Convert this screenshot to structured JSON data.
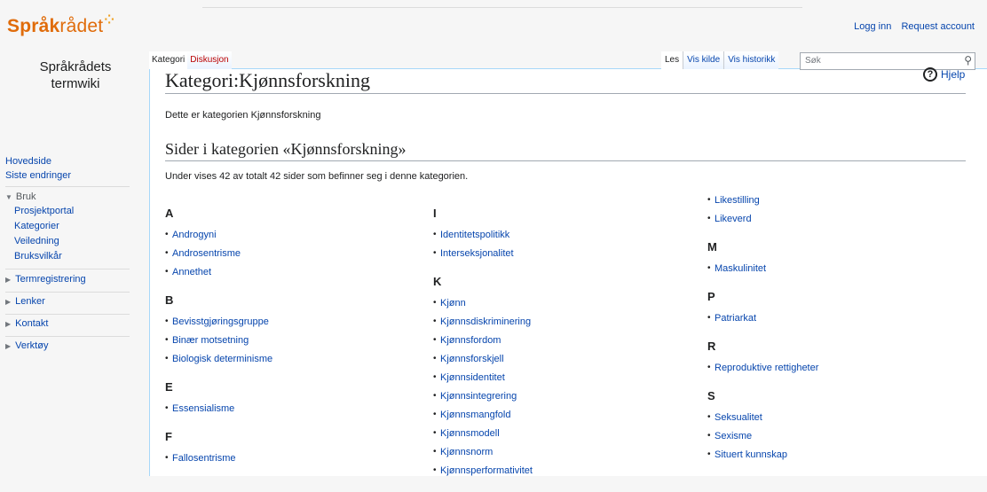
{
  "header": {
    "logo_strong": "Språk",
    "logo_light": "rådet",
    "logo_mark": "⁘",
    "login": "Logg inn",
    "request_account": "Request account"
  },
  "sidebar": {
    "site_name": "Språkrådets termwiki",
    "main_links": [
      "Hovedside",
      "Siste endringer"
    ],
    "bruk": {
      "label": "Bruk",
      "items": [
        "Prosjektportal",
        "Kategorier",
        "Veiledning",
        "Bruksvilkår"
      ]
    },
    "collapsed": [
      "Termregistrering",
      "Lenker",
      "Kontakt",
      "Verktøy"
    ]
  },
  "tabs": {
    "left": [
      "Kategori",
      "Diskusjon"
    ],
    "right": [
      "Les",
      "Vis kilde",
      "Vis historikk"
    ]
  },
  "search": {
    "placeholder": "Søk"
  },
  "help": "Hjelp",
  "page": {
    "title": "Kategori:Kjønnsforskning",
    "description": "Dette er kategorien Kjønnsforskning",
    "section_title": "Sider i kategorien «Kjønnsforskning»",
    "count_text": "Under vises 42 av totalt 42 sider som befinner seg i denne kategorien."
  },
  "columns": [
    [
      {
        "letter": "A",
        "items": [
          "Androgyni",
          "Androsentrisme",
          "Annethet"
        ]
      },
      {
        "letter": "B",
        "items": [
          "Bevisstgjøringsgruppe",
          "Binær motsetning",
          "Biologisk determinisme"
        ]
      },
      {
        "letter": "E",
        "items": [
          "Essensialisme"
        ]
      },
      {
        "letter": "F",
        "items": [
          "Fallosentrisme"
        ]
      }
    ],
    [
      {
        "letter": "I",
        "items": [
          "Identitetspolitikk",
          "Interseksjonalitet"
        ]
      },
      {
        "letter": "K",
        "items": [
          "Kjønn",
          "Kjønnsdiskriminering",
          "Kjønnsfordom",
          "Kjønnsforskjell",
          "Kjønnsidentitet",
          "Kjønnsintegrering",
          "Kjønnsmangfold",
          "Kjønnsmodell",
          "Kjønnsnorm",
          "Kjønnsperformativitet"
        ]
      }
    ],
    [
      {
        "letter": "",
        "items": [
          "Likestilling",
          "Likeverd"
        ]
      },
      {
        "letter": "M",
        "items": [
          "Maskulinitet"
        ]
      },
      {
        "letter": "P",
        "items": [
          "Patriarkat"
        ]
      },
      {
        "letter": "R",
        "items": [
          "Reproduktive rettigheter"
        ]
      },
      {
        "letter": "S",
        "items": [
          "Seksualitet",
          "Sexisme",
          "Situert kunnskap"
        ]
      }
    ]
  ]
}
